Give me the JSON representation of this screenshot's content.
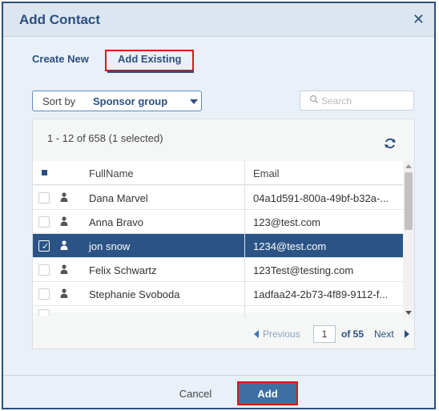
{
  "dialog": {
    "title": "Add Contact",
    "close_icon": "close-icon"
  },
  "tabs": {
    "create_new": "Create New",
    "add_existing": "Add Existing",
    "active": "add_existing"
  },
  "sort": {
    "label": "Sort by",
    "value": "Sponsor group"
  },
  "search": {
    "placeholder": "Search",
    "value": ""
  },
  "grid": {
    "info": "1 - 12 of 658 (1 selected)",
    "columns": [
      "FullName",
      "Email"
    ],
    "rows": [
      {
        "name": "Dana Marvel",
        "email": "04a1d591-800a-49bf-b32a-...",
        "selected": false
      },
      {
        "name": "Anna Bravo",
        "email": "123@test.com",
        "selected": false
      },
      {
        "name": "jon snow",
        "email": "1234@test.com",
        "selected": true
      },
      {
        "name": "Felix Schwartz",
        "email": "123Test@testing.com",
        "selected": false
      },
      {
        "name": "Stephanie Svoboda",
        "email": "1adfaa24-2b73-4f89-9112-f...",
        "selected": false
      }
    ]
  },
  "pager": {
    "previous": "Previous",
    "page": "1",
    "of": "of 55",
    "next": "Next"
  },
  "footer": {
    "cancel": "Cancel",
    "add": "Add"
  },
  "colors": {
    "accent": "#2b4f7e",
    "selected_row": "#2b5385",
    "highlight_box": "#e0151c"
  }
}
